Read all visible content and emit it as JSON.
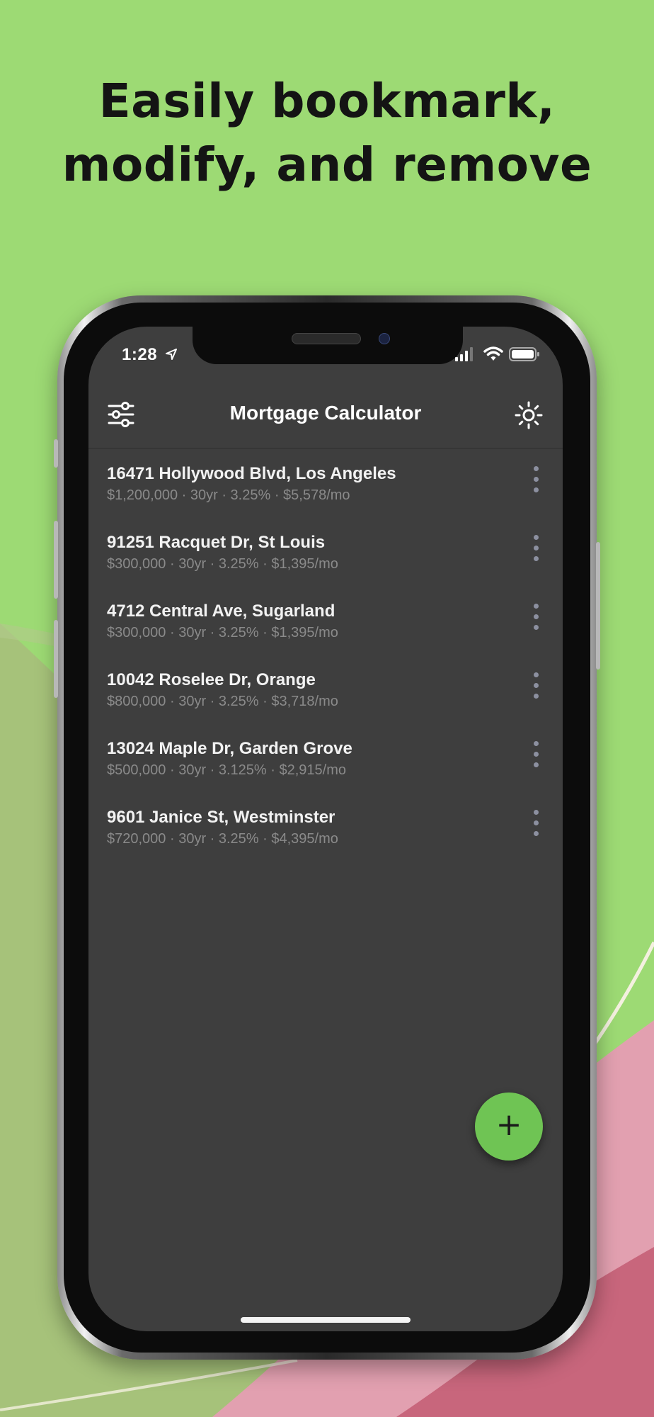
{
  "promo": {
    "headline_line1": "Easily bookmark,",
    "headline_line2": "modify, and remove"
  },
  "status_bar": {
    "time": "1:28"
  },
  "app_bar": {
    "title": "Mortgage Calculator",
    "left_icon": "filter-sliders-icon",
    "right_icon": "brightness-icon"
  },
  "bookmarks": [
    {
      "address": "16471 Hollywood Blvd, Los Angeles",
      "details": "$1,200,000 · 30yr  · 3.25% · $5,578/mo"
    },
    {
      "address": "91251 Racquet Dr, St Louis",
      "details": "$300,000 · 30yr  · 3.25% · $1,395/mo"
    },
    {
      "address": "4712 Central Ave, Sugarland",
      "details": "$300,000 · 30yr  · 3.25% · $1,395/mo"
    },
    {
      "address": "10042 Roselee Dr, Orange",
      "details": "$800,000 · 30yr  · 3.25% · $3,718/mo"
    },
    {
      "address": "13024 Maple Dr, Garden Grove",
      "details": "$500,000 · 30yr  · 3.125% · $2,915/mo"
    },
    {
      "address": "9601 Janice St, Westminster",
      "details": "$720,000 · 30yr  · 3.25% · $4,395/mo"
    }
  ],
  "fab": {
    "label": "+"
  },
  "colors": {
    "background": "#9dda74",
    "screen": "#3e3e3e",
    "accent": "#6fc454",
    "pink": "#e0a0b0"
  }
}
